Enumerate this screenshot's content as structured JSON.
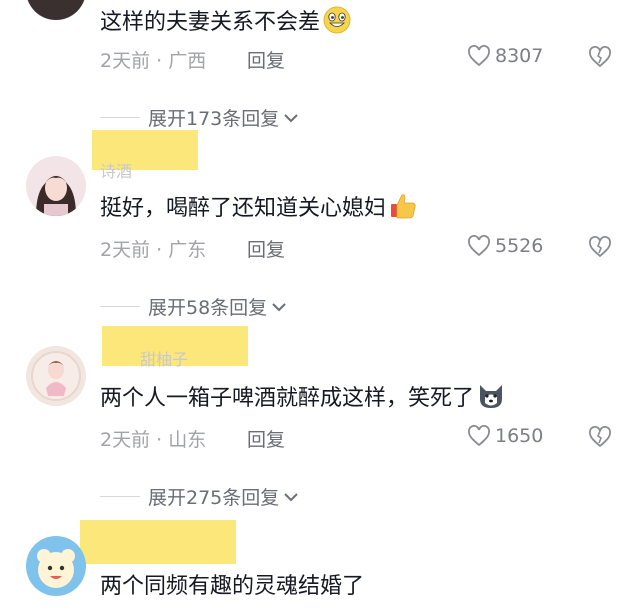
{
  "comments": [
    {
      "username": "",
      "text": "这样的夫妻关系不会差",
      "emoji_icon": "grinning-emoji-icon",
      "time": "2天前",
      "location": "广西",
      "reply_label": "回复",
      "likes": "8307",
      "expand_label": "展开173条回复"
    },
    {
      "username": "诗酒",
      "text": "挺好，喝醉了还知道关心媳妇",
      "emoji_icon": "thumbs-up-icon",
      "time": "2天前",
      "location": "广东",
      "reply_label": "回复",
      "likes": "5526",
      "expand_label": "展开58条回复"
    },
    {
      "username": "甜柚子",
      "text": "两个人一箱子啤酒就醉成这样，笑死了",
      "emoji_icon": "husky-face-icon",
      "time": "2天前",
      "location": "山东",
      "reply_label": "回复",
      "likes": "1650",
      "expand_label": "展开275条回复"
    },
    {
      "username": "",
      "text": "两个同频有趣的灵魂结婚了",
      "emoji_icon": "",
      "time": "",
      "location": "",
      "reply_label": "",
      "likes": "",
      "expand_label": ""
    }
  ],
  "meta_separator": "·",
  "colors": {
    "text": "#161823",
    "meta": "#a2a3a8",
    "highlight_blur": "#fbe46b"
  }
}
